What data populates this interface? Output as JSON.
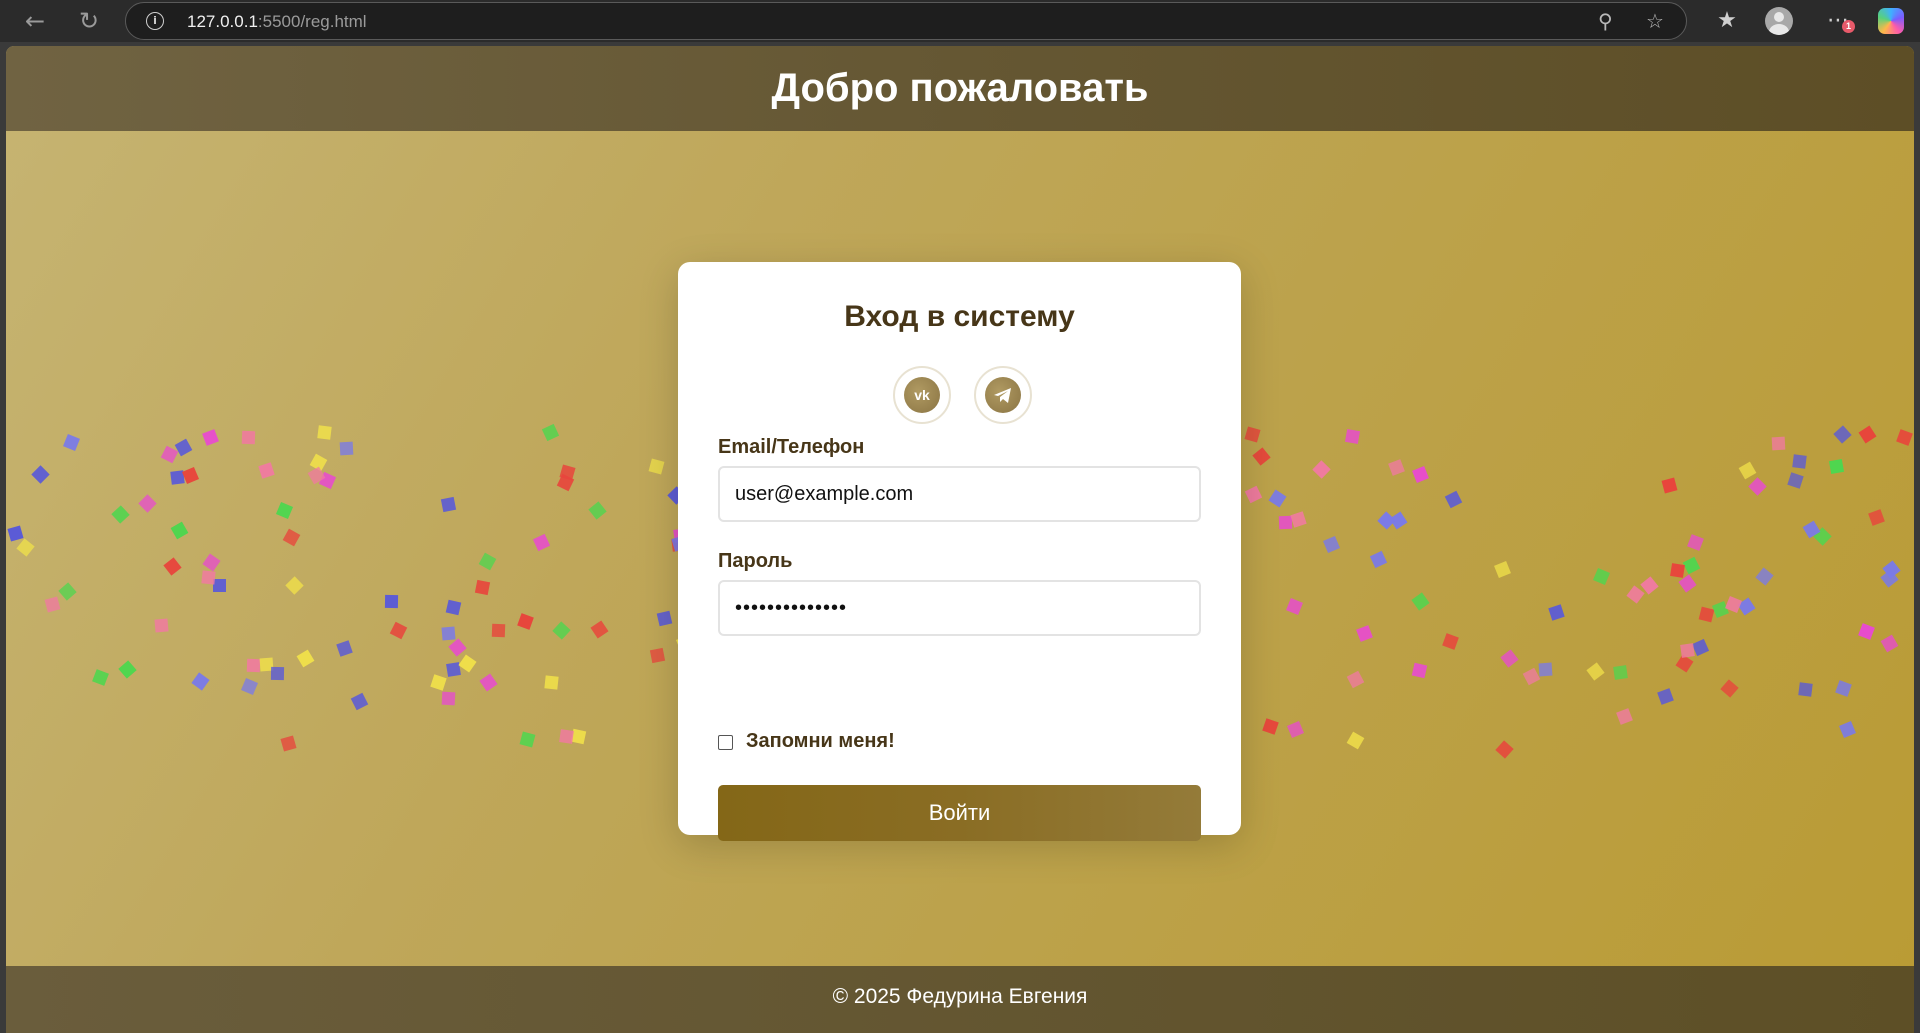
{
  "browser": {
    "url_host": "127.0.0.1",
    "url_path": ":5500/reg.html",
    "notification_count": "1"
  },
  "header": {
    "title": "Добро пожаловать"
  },
  "login": {
    "title": "Вход в систему",
    "social": [
      {
        "name": "vk",
        "label": "vk"
      },
      {
        "name": "telegram",
        "label": "telegram"
      }
    ],
    "email_label": "Email/Телефон",
    "email_value": "user@example.com",
    "password_label": "Пароль",
    "password_value": "••••••••••••••",
    "remember_label": "Запомни меня!",
    "remember_checked": false,
    "submit_label": "Войти"
  },
  "footer": {
    "text": "© 2025 Федурина Евгения"
  },
  "colors": {
    "accent": "#846717",
    "title_text": "#473618",
    "header_bg": "#655733"
  },
  "confetti_colors": [
    "#e8453c",
    "#e84bcf",
    "#5b5bd6",
    "#4fd64f",
    "#f0e04a",
    "#f07aa0",
    "#7a7ae8"
  ]
}
